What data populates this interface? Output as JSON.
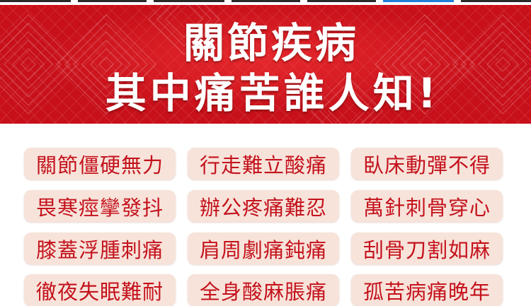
{
  "banner": {
    "title_line_1": "關節疾病",
    "title_line_2": "其中痛苦誰人知!"
  },
  "colors": {
    "banner_red": "#c8101a",
    "tag_background": "#f7e3da",
    "tag_text": "#c4121c"
  },
  "symptoms": [
    "關節僵硬無力",
    "行走難立酸痛",
    "臥床動彈不得",
    "畏寒痙攣發抖",
    "辦公疼痛難忍",
    "萬針刺骨穿心",
    "膝蓋浮腫刺痛",
    "肩周劇痛鈍痛",
    "刮骨刀割如麻",
    "徹夜失眠難耐",
    "全身酸麻脹痛",
    "孤苦病痛晚年"
  ]
}
